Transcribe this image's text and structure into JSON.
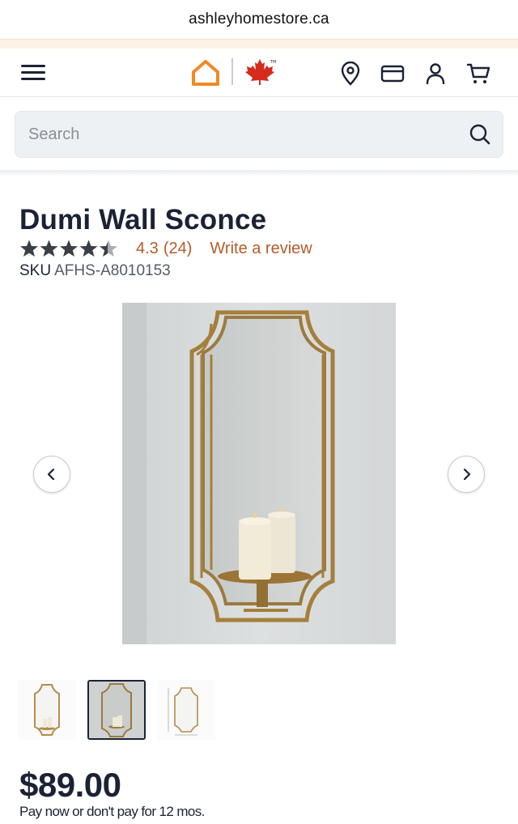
{
  "browser": {
    "url": "ashleyhomestore.ca"
  },
  "header": {
    "icons": {
      "menu": "hamburger-menu-icon",
      "home": "house-logo-icon",
      "flag": "maple-leaf-icon",
      "store": "map-pin-icon",
      "credit": "credit-card-icon",
      "account": "user-icon",
      "cart": "cart-icon"
    },
    "brand_color": "#f08a24",
    "maple_color": "#d52b1e",
    "trademark": "TM"
  },
  "search": {
    "placeholder": "Search"
  },
  "product": {
    "title": "Dumi Wall Sconce",
    "rating": 4.3,
    "rating_text": "4.3",
    "review_count_text": "(24)",
    "write_review_label": "Write a review",
    "sku_label": "SKU",
    "sku_value": "AFHS-A8010153",
    "price": "$89.00",
    "finance_text": "Pay now or don't pay for 12 mos.",
    "accent_color": "#b35c2a"
  },
  "gallery": {
    "thumbnail_count": 3,
    "active_index": 1
  }
}
